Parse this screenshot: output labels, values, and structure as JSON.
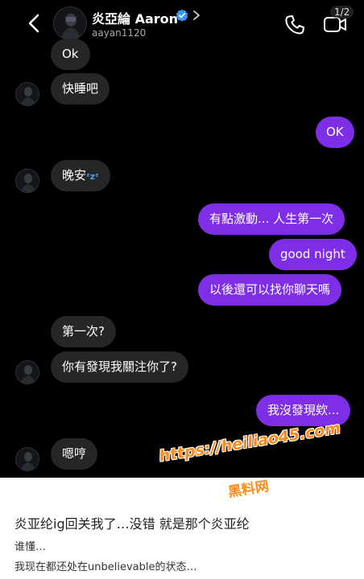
{
  "header": {
    "name": "炎亞綸 Aaron",
    "handle": "aayan1120",
    "page_indicator": "1/2"
  },
  "messages": [
    {
      "side": "in",
      "text": "Ok",
      "avatar": false
    },
    {
      "side": "in",
      "text": "快睡吧",
      "avatar": true
    },
    {
      "side": "out",
      "text": "OK"
    },
    {
      "side": "in",
      "text": "晚安",
      "emoji": "zzz",
      "avatar": true
    },
    {
      "side": "out",
      "text": "有點激動... 人生第一次"
    },
    {
      "side": "out",
      "text": "good night"
    },
    {
      "side": "out",
      "text": "以後還可以找你聊天嗎"
    },
    {
      "side": "in",
      "text": "第一次?",
      "avatar": false
    },
    {
      "side": "in",
      "text": "你有發現我關注你了?",
      "avatar": true
    },
    {
      "side": "out",
      "text": "我沒發現欸..."
    },
    {
      "side": "in",
      "text": "嗯哼",
      "avatar": true
    }
  ],
  "caption": {
    "title": "炎亚纶ig回关我了…没错 就是那个炎亚纶",
    "line1": "谁懂…",
    "line2": "我现在都还处在unbelievable的状态…"
  },
  "watermark": {
    "url": "https://heiliao45.com",
    "name": "黑料网"
  },
  "colors": {
    "background": "#000000",
    "incoming_bubble": "#262626",
    "outgoing_bubble": "#7e2ee6",
    "verified": "#3897f0",
    "watermark": "#ff8a1a"
  }
}
